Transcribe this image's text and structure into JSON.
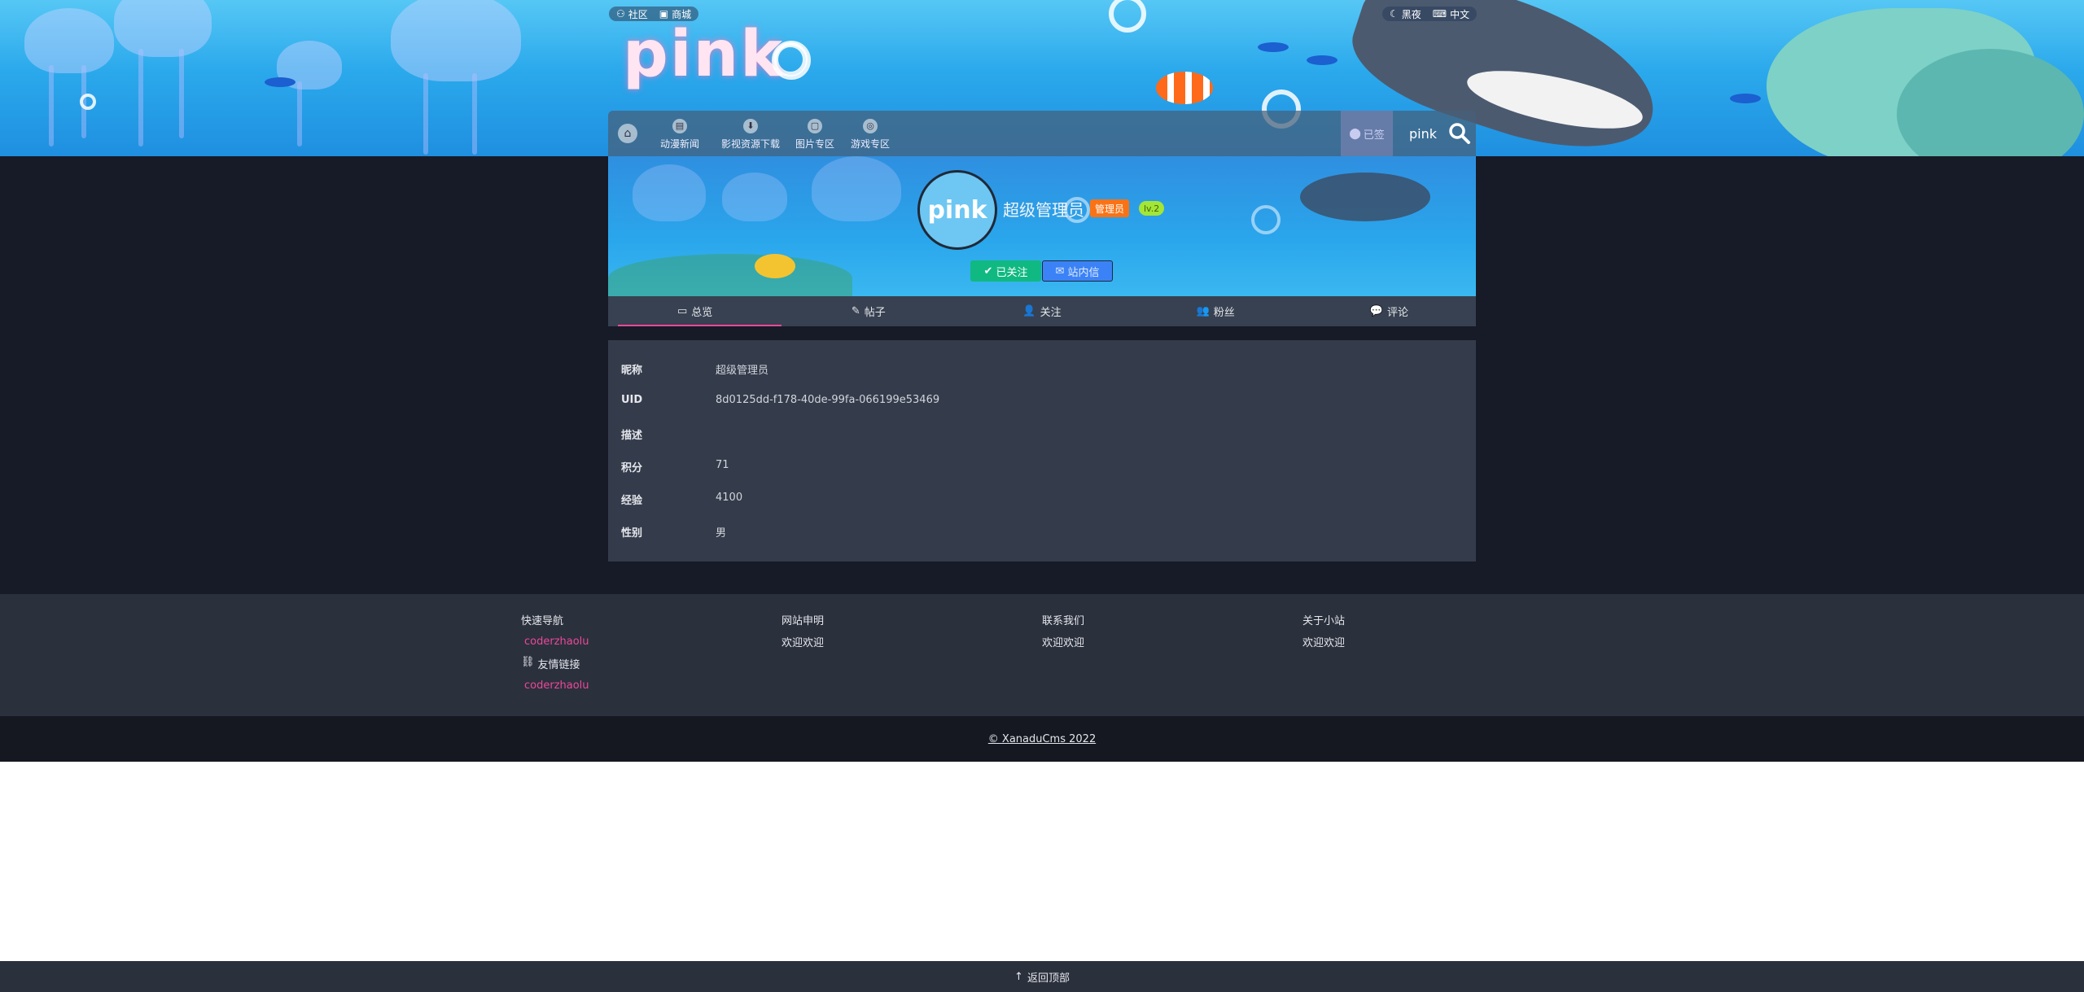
{
  "topbar": {
    "community": "社区",
    "shop": "商城",
    "theme": "黑夜",
    "language": "中文"
  },
  "logo": {
    "text": "pink"
  },
  "nav": {
    "items": [
      {
        "label": "动漫新闻"
      },
      {
        "label": "影视资源下载"
      },
      {
        "label": "图片专区"
      },
      {
        "label": "游戏专区"
      }
    ],
    "signin": "已签",
    "user_logo": "pink"
  },
  "profile": {
    "avatar_text": "pink",
    "username": "超级管理员",
    "badge_admin": "管理员",
    "badge_level": "lv.2",
    "follow_label": "已关注",
    "message_label": "站内信"
  },
  "tabs": [
    {
      "label": "总览",
      "icon": "id-card-icon"
    },
    {
      "label": "帖子",
      "icon": "pencil-icon"
    },
    {
      "label": "关注",
      "icon": "user-plus-icon"
    },
    {
      "label": "粉丝",
      "icon": "users-icon"
    },
    {
      "label": "评论",
      "icon": "comments-icon"
    }
  ],
  "info": {
    "nickname_label": "昵称",
    "nickname": "超级管理员",
    "uid_label": "UID",
    "uid": "8d0125dd-f178-40de-99fa-066199e53469",
    "desc_label": "描述",
    "desc": "",
    "points_label": "积分",
    "points": "71",
    "exp_label": "经验",
    "exp": "4100",
    "gender_label": "性别",
    "gender": "男"
  },
  "footer": {
    "quick_nav": "快速导航",
    "quick_link": "coderzhaolu",
    "friend_links": "友情链接",
    "friend_link": "coderzhaolu",
    "statement_title": "网站申明",
    "statement_text": "欢迎欢迎",
    "contact_title": "联系我们",
    "contact_text": "欢迎欢迎",
    "about_title": "关于小站",
    "about_text": "欢迎欢迎",
    "copyright": "© XanaduCms 2022"
  },
  "backtop": {
    "label": "返回顶部"
  },
  "colors": {
    "accent_pink": "#ec4899",
    "follow_green": "#10b981",
    "message_blue": "#3b82f6",
    "admin_orange": "#f97316",
    "level_lime": "#a3e635"
  }
}
